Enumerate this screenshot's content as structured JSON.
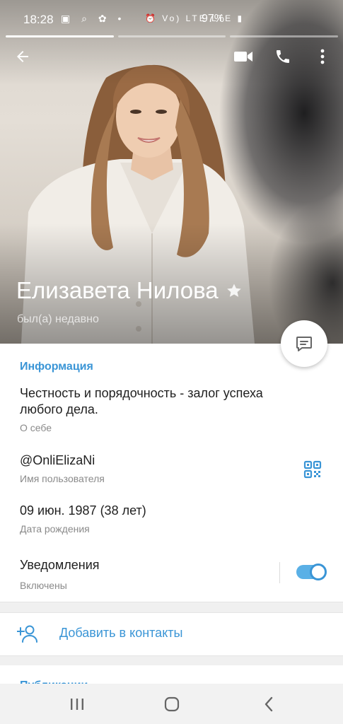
{
  "status_bar": {
    "time": "18:28",
    "left_icons": "▣ ⌕ ✿ •",
    "right_icons": "⏰ Vo) LTE LTE ▮",
    "battery": "97%"
  },
  "profile": {
    "name": "Елизавета Нилова",
    "status": "был(а) недавно"
  },
  "info": {
    "title": "Информация",
    "bio": "Честность и порядочность - залог успеха любого дела.",
    "bio_label": "О себе",
    "username": "@OnliElizaNi",
    "username_label": "Имя пользователя",
    "birthday": "09 июн. 1987 (38 лет)",
    "birthday_label": "Дата рождения",
    "notifications": "Уведомления",
    "notifications_state": "Включены"
  },
  "actions": {
    "add_contact": "Добавить в контакты"
  },
  "publications": {
    "title": "Публикации"
  },
  "colors": {
    "accent": "#3a95d6",
    "toggle_on": "#5ab0e6",
    "text_primary": "#1f1f1f",
    "text_secondary": "#8a8a8a"
  },
  "icons": {
    "back": "arrow-left-icon",
    "video": "video-camera-icon",
    "call": "phone-icon",
    "more": "more-vertical-icon",
    "message": "message-icon",
    "qr": "qr-code-icon",
    "star": "star-icon",
    "add_contact": "add-person-icon"
  }
}
